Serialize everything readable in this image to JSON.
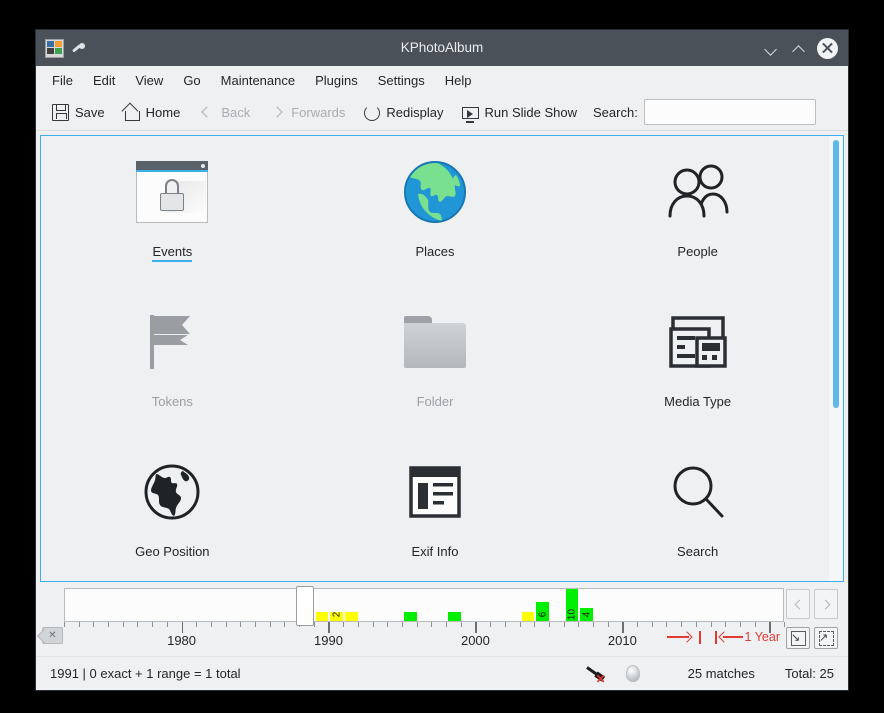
{
  "window": {
    "title": "KPhotoAlbum",
    "app_icon": "photo-album-icon",
    "pin_icon": "pin-icon",
    "minimize_label": "⌄",
    "maximize_label": "⌃",
    "close_label": "✕"
  },
  "menubar": {
    "items": [
      {
        "label": "File"
      },
      {
        "label": "Edit"
      },
      {
        "label": "View"
      },
      {
        "label": "Go"
      },
      {
        "label": "Maintenance"
      },
      {
        "label": "Plugins"
      },
      {
        "label": "Settings"
      },
      {
        "label": "Help"
      }
    ]
  },
  "toolbar": {
    "buttons": [
      {
        "label": "Save",
        "icon": "save-icon",
        "enabled": true
      },
      {
        "label": "Home",
        "icon": "home-icon",
        "enabled": true
      },
      {
        "label": "Back",
        "icon": "chevron-left-icon",
        "enabled": false
      },
      {
        "label": "Forwards",
        "icon": "chevron-right-icon",
        "enabled": false
      },
      {
        "label": "Redisplay",
        "icon": "refresh-icon",
        "enabled": true
      },
      {
        "label": "Run Slide Show",
        "icon": "slideshow-icon",
        "enabled": true
      }
    ],
    "search_label": "Search:",
    "search_value": "",
    "search_placeholder": ""
  },
  "categories": [
    {
      "label": "Events",
      "icon": "locked-window-icon",
      "enabled": true,
      "hovered": true
    },
    {
      "label": "Places",
      "icon": "globe-color-icon",
      "enabled": true,
      "hovered": false
    },
    {
      "label": "People",
      "icon": "people-icon",
      "enabled": true,
      "hovered": false
    },
    {
      "label": "Tokens",
      "icon": "flag-icon",
      "enabled": false,
      "hovered": false
    },
    {
      "label": "Folder",
      "icon": "folder-icon",
      "enabled": false,
      "hovered": false
    },
    {
      "label": "Media Type",
      "icon": "media-type-icon",
      "enabled": true,
      "hovered": false
    },
    {
      "label": "Geo Position",
      "icon": "globe-outline-icon",
      "enabled": true,
      "hovered": false
    },
    {
      "label": "Exif Info",
      "icon": "exif-info-icon",
      "enabled": true,
      "hovered": false
    },
    {
      "label": "Search",
      "icon": "magnifier-icon",
      "enabled": true,
      "hovered": false
    }
  ],
  "datebar": {
    "clear_icon": "clear-date-icon",
    "prev_icon": "chevron-left-icon",
    "next_icon": "chevron-right-icon",
    "zoom_out_icon": "zoom-out-icon",
    "zoom_fit_icon": "zoom-fit-icon",
    "scale_label": "1 Year",
    "scale_arrow_right_icon": "arrow-right-icon",
    "scale_arrow_left_icon": "arrow-left-icon",
    "year_labels": [
      "1980",
      "1990",
      "2000",
      "2010"
    ],
    "axis_start_year": 1972,
    "axis_end_year": 2021,
    "cursor_year": 1988,
    "bars": [
      {
        "year": 1989,
        "count": 1,
        "label": "",
        "color": "#ffff00"
      },
      {
        "year": 1990,
        "count": 2,
        "label": "2",
        "color": "#ffff00"
      },
      {
        "year": 1991,
        "count": 1,
        "label": "",
        "color": "#ffff00"
      },
      {
        "year": 1995,
        "count": 1,
        "label": "",
        "color": "#00ee00"
      },
      {
        "year": 1998,
        "count": 1,
        "label": "",
        "color": "#00ee00"
      },
      {
        "year": 2003,
        "count": 1,
        "label": "",
        "color": "#ffff00"
      },
      {
        "year": 2004,
        "count": 6,
        "label": "6",
        "color": "#00ee00"
      },
      {
        "year": 2006,
        "count": 10,
        "label": "10",
        "color": "#00ee00"
      },
      {
        "year": 2007,
        "count": 4,
        "label": "4",
        "color": "#00ee00"
      }
    ]
  },
  "statusbar": {
    "left_text": "1991 | 0 exact + 1 range = 1 total",
    "plug_icon": "plugin-disconnected-icon",
    "lamp_icon": "status-lamp-icon",
    "matches_text": "25 matches",
    "total_text": "Total: 25"
  },
  "colors": {
    "accent": "#3daee9",
    "titlebar": "#4b5159",
    "background": "#eff0f1",
    "bar_yellow": "#ffff00",
    "bar_green": "#00ee00",
    "scale_red": "#e03a32"
  }
}
